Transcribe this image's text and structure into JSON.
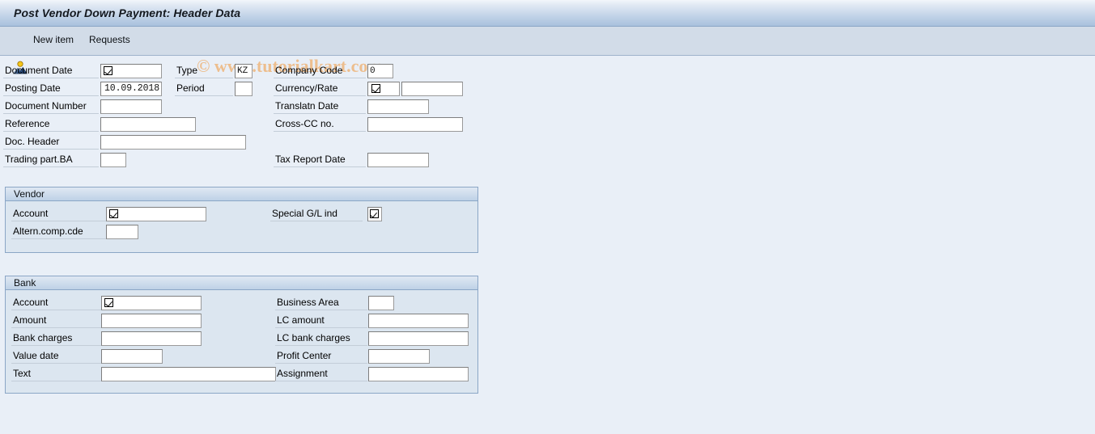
{
  "window": {
    "title": "Post Vendor Down Payment: Header Data"
  },
  "toolbar": {
    "icon_name": "picture-icon",
    "new_item_label": "New item",
    "requests_label": "Requests",
    "watermark": "© www.tutorialkart.com"
  },
  "header_form": {
    "left_column": [
      {
        "label": "Document Date",
        "value": "",
        "required": true
      },
      {
        "label": "Posting Date",
        "value": "10.09.2018",
        "required": false
      },
      {
        "label": "Document Number",
        "value": "",
        "required": false
      },
      {
        "label": "Reference",
        "value": "",
        "required": false
      },
      {
        "label": "Doc. Header",
        "value": "",
        "required": false
      },
      {
        "label": "Trading part.BA",
        "value": "",
        "required": false
      }
    ],
    "middle_column": [
      {
        "label": "Type",
        "value": "KZ",
        "required": false
      },
      {
        "label": "Period",
        "value": "",
        "required": false
      }
    ],
    "right_column": [
      {
        "label": "Company Code",
        "value": "0",
        "required": false
      },
      {
        "label": "Currency/Rate",
        "value": "",
        "required": true
      },
      {
        "label": "Translatn Date",
        "value": "",
        "required": false
      },
      {
        "label": "Cross-CC no.",
        "value": "",
        "required": false
      },
      {
        "label": "Tax Report Date",
        "value": "",
        "required": false
      }
    ],
    "rate_value": ""
  },
  "vendor_section": {
    "title": "Vendor",
    "fields": [
      {
        "label": "Account",
        "value": "",
        "required": true
      },
      {
        "label": "Altern.comp.cde",
        "value": "",
        "required": false
      },
      {
        "label": "Special G/L ind",
        "value": "",
        "required": true
      }
    ]
  },
  "bank_section": {
    "title": "Bank",
    "left_fields": [
      {
        "label": "Account",
        "value": "",
        "required": true
      },
      {
        "label": "Amount",
        "value": "",
        "required": false
      },
      {
        "label": "Bank charges",
        "value": "",
        "required": false
      },
      {
        "label": "Value date",
        "value": "",
        "required": false
      },
      {
        "label": "Text",
        "value": "",
        "required": false
      }
    ],
    "right_fields": [
      {
        "label": "Business Area",
        "value": "",
        "required": false
      },
      {
        "label": "LC amount",
        "value": "",
        "required": false
      },
      {
        "label": "LC bank charges",
        "value": "",
        "required": false
      },
      {
        "label": "Profit Center",
        "value": "",
        "required": false
      },
      {
        "label": "Assignment",
        "value": "",
        "required": false
      }
    ]
  },
  "colors": {
    "titlebar_top": "#f2f6fb",
    "titlebar_bottom": "#a9c1dd",
    "toolbar_bg": "#d2dce8",
    "body_bg": "#e9eff7",
    "panel_bg": "#dce6f0",
    "panel_border": "#8ba6c6",
    "watermark": "#edbe8e",
    "field_bg": "#ffffff",
    "field_border": "#9a9a9a"
  }
}
